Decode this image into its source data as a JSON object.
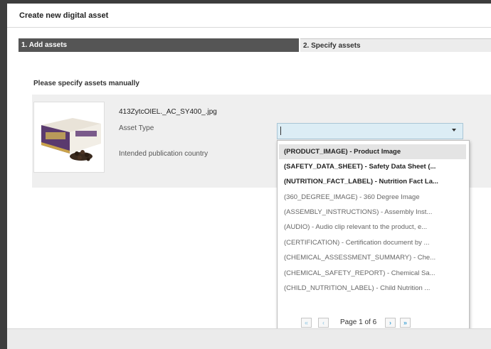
{
  "dialog": {
    "title": "Create new digital asset"
  },
  "steps": [
    {
      "label": "1. Add assets",
      "active": true
    },
    {
      "label": "2. Specify assets",
      "active": false
    }
  ],
  "section": {
    "label": "Please specify assets manually"
  },
  "asset": {
    "file_name": "413ZytcOIEL._AC_SY400_.jpg",
    "asset_type_label": "Asset Type",
    "country_label": "Intended publication country",
    "asset_type_value": ""
  },
  "dropdown": {
    "items": [
      {
        "label": "(PRODUCT_IMAGE) - Product Image",
        "style": "bold"
      },
      {
        "label": "(SAFETY_DATA_SHEET) - Safety Data Sheet (...",
        "style": "bold"
      },
      {
        "label": "(NUTRITION_FACT_LABEL) - Nutrition Fact La...",
        "style": "bold"
      },
      {
        "label": "(360_DEGREE_IMAGE) - 360 Degree Image",
        "style": "normal"
      },
      {
        "label": "(ASSEMBLY_INSTRUCTIONS) - Assembly Inst...",
        "style": "normal"
      },
      {
        "label": "(AUDIO) - Audio clip relevant to the product, e...",
        "style": "normal"
      },
      {
        "label": "(CERTIFICATION) - Certification document by ...",
        "style": "normal"
      },
      {
        "label": "(CHEMICAL_ASSESSMENT_SUMMARY) - Che...",
        "style": "normal"
      },
      {
        "label": "(CHEMICAL_SAFETY_REPORT) - Chemical Sa...",
        "style": "normal"
      },
      {
        "label": "(CHILD_NUTRITION_LABEL) - Child Nutrition ...",
        "style": "normal"
      }
    ],
    "highlighted_index": 0,
    "pager": {
      "text": "Page 1 of 6",
      "first_icon": "«",
      "prev_icon": "‹",
      "next_icon": "›",
      "last_icon": "»"
    }
  },
  "colors": {
    "active_step": "#555555",
    "input_focus": "#dcedf5",
    "pager_accent": "#49a6d6"
  }
}
